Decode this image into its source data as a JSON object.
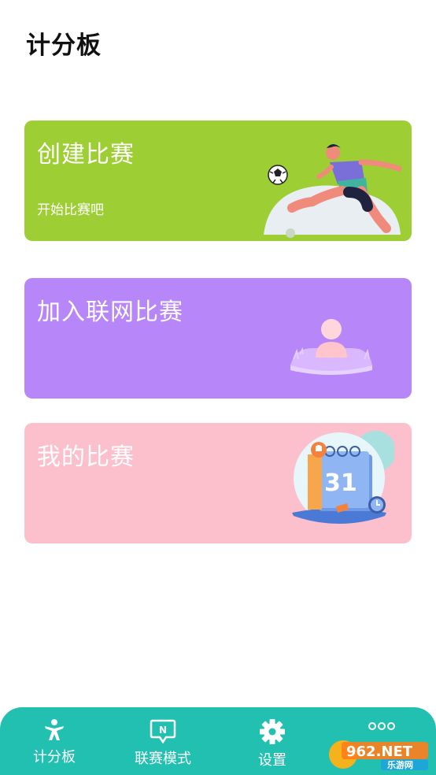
{
  "page": {
    "title": "计分板"
  },
  "cards": [
    {
      "title": "创建比赛",
      "subtitle": "开始比赛吧",
      "color": "#9dce34",
      "icon": "soccer-player-icon"
    },
    {
      "title": "加入联网比赛",
      "subtitle": "",
      "color": "#b786f8",
      "icon": "person-avatar-icon"
    },
    {
      "title": "我的比赛",
      "subtitle": "",
      "color": "#fcc0cc",
      "icon": "calendar-icon"
    }
  ],
  "calendar_day": "31",
  "tabs": [
    {
      "label": "计分板",
      "icon": "athlete-icon"
    },
    {
      "label": "联赛模式",
      "icon": "n-badge-icon"
    },
    {
      "label": "设置",
      "icon": "gear-icon"
    },
    {
      "label": "",
      "icon": "more-dots-icon"
    }
  ],
  "watermark": {
    "brand": "962.NET",
    "site": "乐游网"
  },
  "colors": {
    "tabbar": "#21c0b1",
    "background": "#ffffff"
  }
}
